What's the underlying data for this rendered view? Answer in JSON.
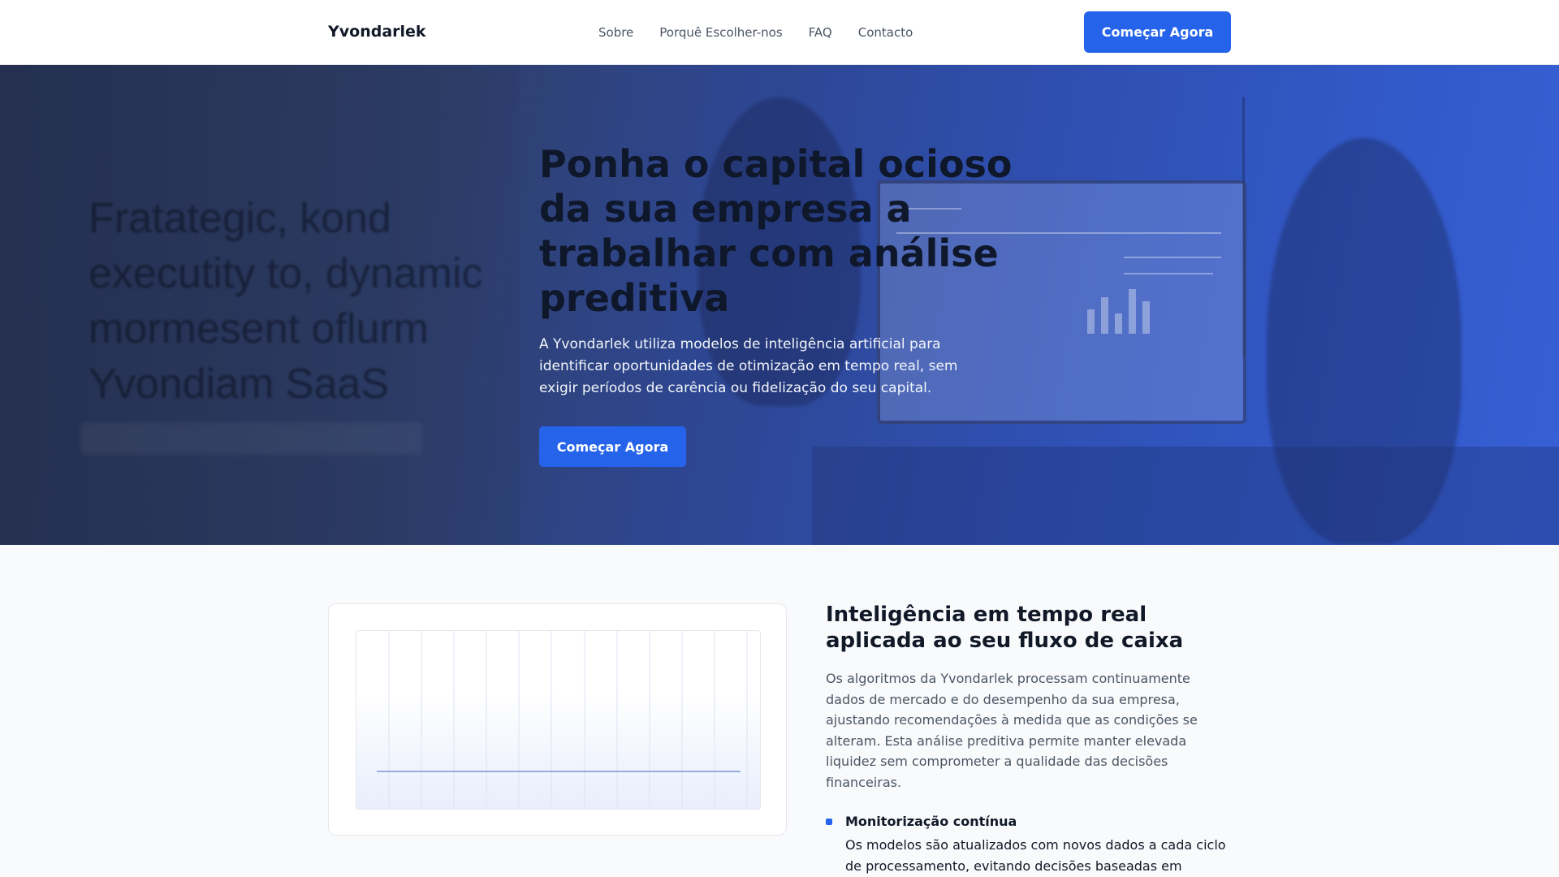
{
  "header": {
    "brand": "Yvondarlek",
    "nav": [
      "Sobre",
      "Porquê Escolher-nos",
      "FAQ",
      "Contacto"
    ],
    "cta_label": "Começar Agora"
  },
  "hero": {
    "background_text": "Fratategic, kond executity to, dynamic mormesent oflurm Yvondiam SaaS",
    "title": "Ponha o capital ocioso da sua empresa a trabalhar com análise preditiva",
    "subtitle": "A Yvondarlek utiliza modelos de inteligência artificial para identificar oportunidades de otimização em tempo real, sem exigir períodos de carência ou fidelização do seu capital.",
    "cta_label": "Começar Agora"
  },
  "feature": {
    "title": "Inteligência em tempo real aplicada ao seu fluxo de caixa",
    "body": "Os algoritmos da Yvondarlek processam continuamente dados de mercado e do desempenho da sua empresa, ajustando recomendações à medida que as condições se alteram. Esta análise preditiva permite manter elevada liquidez sem comprometer a qualidade das decisões financeiras.",
    "bullets": [
      {
        "title": "Monitorização contínua",
        "body": "Os modelos são atualizados com novos dados a cada ciclo de processamento, evitando decisões baseadas em"
      }
    ]
  },
  "colors": {
    "accent": "#2563eb",
    "hero_overlay": "#2f4fb0",
    "text_dark": "#111827",
    "text_muted": "#4b5563"
  }
}
